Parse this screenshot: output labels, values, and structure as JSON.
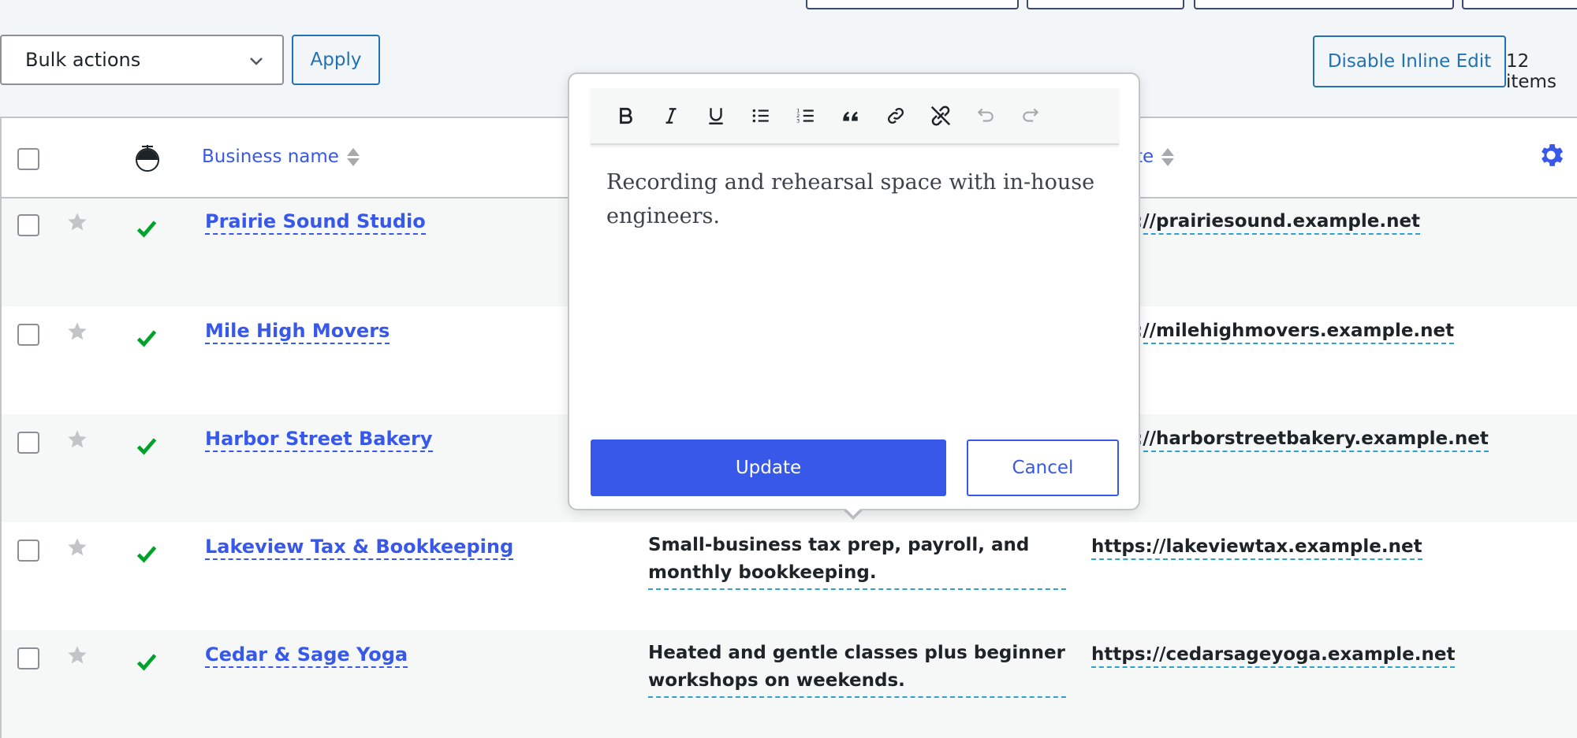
{
  "toolbar": {
    "bulk_actions_label": "Bulk actions",
    "apply_label": "Apply",
    "disable_inline_edit_label": "Disable Inline Edit",
    "items_count": "12 items"
  },
  "table": {
    "columns": {
      "business_name": "Business name",
      "website": "te"
    },
    "rows": [
      {
        "name": "Prairie Sound Studio",
        "description": "",
        "website": "://prairiesound.example.net"
      },
      {
        "name": "Mile High Movers",
        "description": "",
        "website": "://milehighmovers.example.net"
      },
      {
        "name": "Harbor Street Bakery",
        "description": "",
        "website": "://harborstreetbakery.example.net"
      },
      {
        "name": "Lakeview Tax & Bookkeeping",
        "description": "Small-business tax prep, payroll, and monthly bookkeeping.",
        "website": "https://lakeviewtax.example.net"
      },
      {
        "name": "Cedar & Sage Yoga",
        "description": "Heated and gentle classes plus beginner workshops on weekends.",
        "website": "https://cedarsageyoga.example.net"
      }
    ]
  },
  "editor": {
    "content": "Recording and rehearsal space with in-house engineers.",
    "update_label": "Update",
    "cancel_label": "Cancel",
    "toolbar_icons": [
      "bold-icon",
      "italic-icon",
      "underline-icon",
      "bullet-list-icon",
      "numbered-list-icon",
      "blockquote-icon",
      "link-icon",
      "unlink-icon",
      "undo-icon",
      "redo-icon"
    ]
  },
  "colors": {
    "accent": "#3858e9",
    "check_green": "#00a32a",
    "star_gray": "#c3c4c7"
  }
}
